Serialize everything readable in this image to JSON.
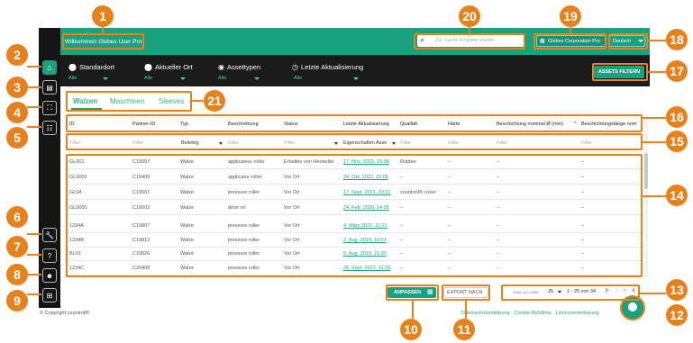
{
  "header": {
    "welcome": "Willkommen Globes User Pro",
    "search_placeholder": "Zur Suche Eingabe starten",
    "company": "Globex Corporation Pro",
    "language": "Deutsch"
  },
  "filters": [
    {
      "label": "Standardort",
      "value": "Alle",
      "icon": "location-icon"
    },
    {
      "label": "Aktueller Ort",
      "value": "Alle",
      "icon": "map-pin-icon"
    },
    {
      "label": "Assettypen",
      "value": "Alle",
      "icon": "radio-icon"
    },
    {
      "label": "Letzte Aktualisierung",
      "value": "Alle",
      "icon": "clock-icon"
    }
  ],
  "filter_button": "ASSETS FILTERN",
  "tabs": [
    "Walzen",
    "Maschinen",
    "Sleeves"
  ],
  "columns": [
    "ID",
    "Partner-ID",
    "Typ",
    "Beschreibung",
    "Status",
    "Letzte Aktualisierung",
    "Qualität",
    "Härte",
    "Beschichtung nominal Ø (mm)",
    "Beschichtungslänge nom"
  ],
  "filter_row": {
    "filter": "Filter",
    "typ_value": "Beliebig",
    "update_value": "Eigenschaften Asse"
  },
  "rows": [
    [
      "GL001",
      "C19097",
      "Walze",
      "applicateur roller",
      "Erhalten von Hersteller",
      "17. Nov. 2022, 15:38",
      "Rubber",
      "–",
      "–",
      "–"
    ],
    [
      "GL0002",
      "C19499",
      "Walze",
      "applicator roller",
      "Vor Ort",
      "24. Okt. 2022, 15:05",
      "–",
      "–",
      "–",
      "–"
    ],
    [
      "GL04",
      "C19501",
      "Walze",
      "pressure roller",
      "Vor Ort",
      "17. Sept. 2021, 10:21",
      "countroll® cover",
      "–",
      "–",
      "–"
    ],
    [
      "GL0050",
      "C19502",
      "Walze",
      "drive rol",
      "Vor Ort",
      "24. Feb. 2020, 14:05",
      "–",
      "–",
      "–",
      "–"
    ],
    [
      "1234A",
      "C19807",
      "Walze",
      "pressure roller",
      "Vor Ort",
      "4. März 2022, 11:21",
      "–",
      "–",
      "–",
      "–"
    ],
    [
      "1234B",
      "C19812",
      "Walze",
      "pressure roller",
      "Vor Ort",
      "2. Aug. 2019, 10:01",
      "–",
      "–",
      "–",
      "–"
    ],
    [
      "BL01",
      "C19826",
      "Walze",
      "pressure roller",
      "Vor Ort",
      "5. Aug. 2019, 15:33",
      "–",
      "–",
      "–",
      "–"
    ],
    [
      "1234C",
      "C20498",
      "Walze",
      "pressure roller",
      "Vor Ort",
      "28. Sept. 2022, 11:33",
      "–",
      "–",
      "–",
      "–"
    ]
  ],
  "footer": {
    "anpassen": "ANPASSEN",
    "export": "EXPORT NACH",
    "rows_per_page_label": "Zeilen pro Seite:",
    "rows_per_page": "25",
    "range": "1 - 25 von 34",
    "copyright": "© Copyright countroll®",
    "links": "Datenschutzerklärung · Cookie-Richtlinie · Lizenzvereinbarung"
  },
  "callouts": [
    "1",
    "2",
    "3",
    "4",
    "5",
    "6",
    "7",
    "8",
    "9",
    "10",
    "11",
    "12",
    "13",
    "14",
    "15",
    "16",
    "17",
    "18",
    "19",
    "20",
    "21"
  ],
  "colors": {
    "accent": "#1aa27e",
    "callout": "#e6821e",
    "dark": "#1b1b1b"
  }
}
